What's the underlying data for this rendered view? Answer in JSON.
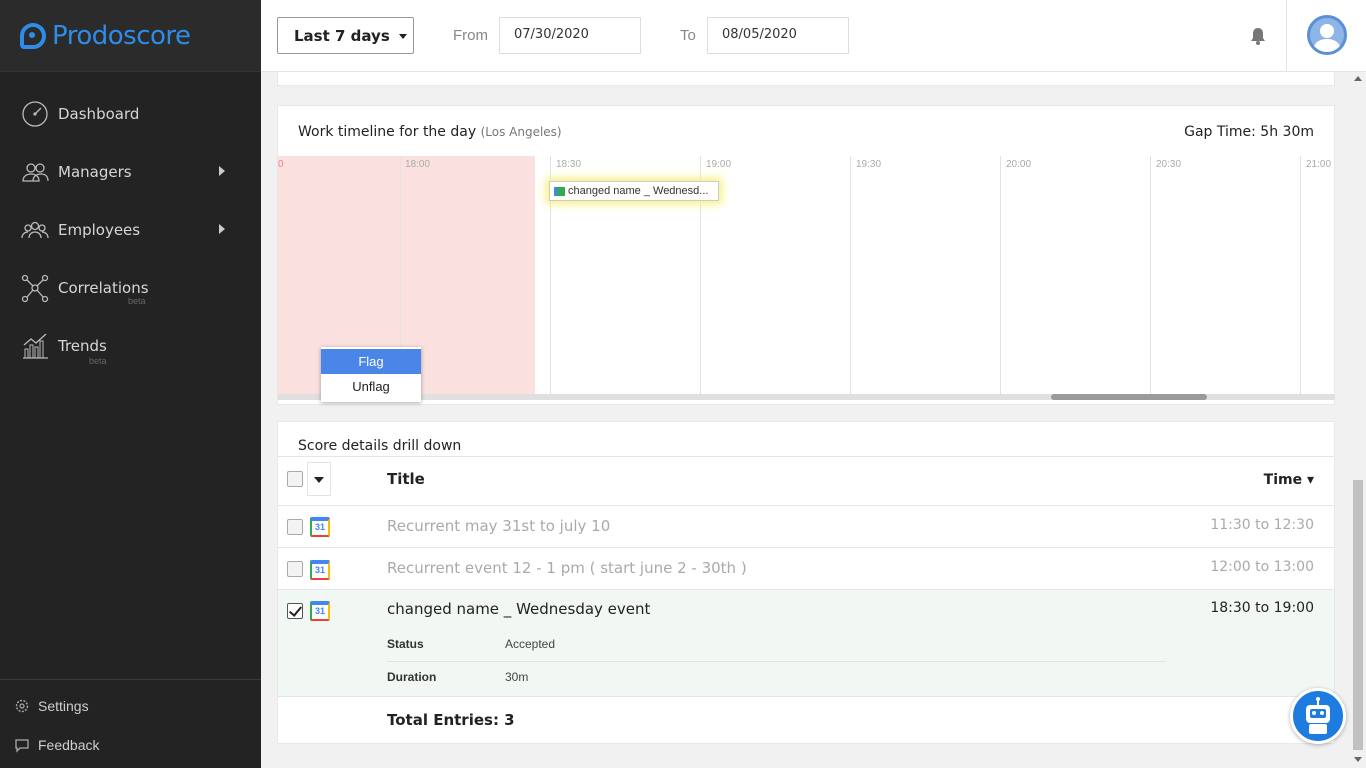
{
  "brand": {
    "name": "Prodoscore"
  },
  "sidebar": {
    "items": [
      {
        "label": "Dashboard",
        "icon": "speedometer-icon",
        "has_arrow": false
      },
      {
        "label": "Managers",
        "icon": "managers-icon",
        "has_arrow": true
      },
      {
        "label": "Employees",
        "icon": "employees-icon",
        "has_arrow": true
      },
      {
        "label": "Correlations",
        "icon": "network-icon",
        "badge": "beta"
      },
      {
        "label": "Trends",
        "icon": "bar-chart-icon",
        "badge": "beta"
      }
    ],
    "bottom": [
      {
        "label": "Settings",
        "icon": "gear-icon"
      },
      {
        "label": "Feedback",
        "icon": "feedback-icon"
      }
    ]
  },
  "header": {
    "range": "Last 7 days",
    "from_label": "From",
    "from_value": "07/30/2020",
    "to_label": "To",
    "to_value": "08/05/2020"
  },
  "timeline": {
    "title": "Work timeline for the day",
    "location": "(Los Angeles)",
    "gap_time": "Gap Time: 5h 30m",
    "partial_tick": "0",
    "ticks": [
      "18:00",
      "18:30",
      "19:00",
      "19:30",
      "20:00",
      "20:30",
      "21:00"
    ],
    "event_label": "changed name _ Wednesd...",
    "context_menu": [
      "Flag",
      "Unflag"
    ]
  },
  "drilldown": {
    "title": "Score details drill down",
    "col_title": "Title",
    "col_time": "Time ▾",
    "rows": [
      {
        "title": "Recurrent may 31st to july 10",
        "time": "11:30 to 12:30",
        "checked": false
      },
      {
        "title": "Recurrent event 12 - 1 pm ( start june 2 - 30th )",
        "time": "12:00 to 13:00",
        "checked": false
      },
      {
        "title": "changed name _ Wednesday event",
        "time": "18:30 to 19:00",
        "checked": true
      }
    ],
    "calendar_day": "31",
    "details": [
      {
        "label": "Status",
        "value": "Accepted"
      },
      {
        "label": "Duration",
        "value": "30m"
      }
    ],
    "total": "Total Entries: 3"
  },
  "colors": {
    "accent": "#2e8ce8",
    "sidebar_bg": "#232323",
    "flag_red": "#fbe0e0",
    "expanded_row": "#f1f8f3"
  }
}
